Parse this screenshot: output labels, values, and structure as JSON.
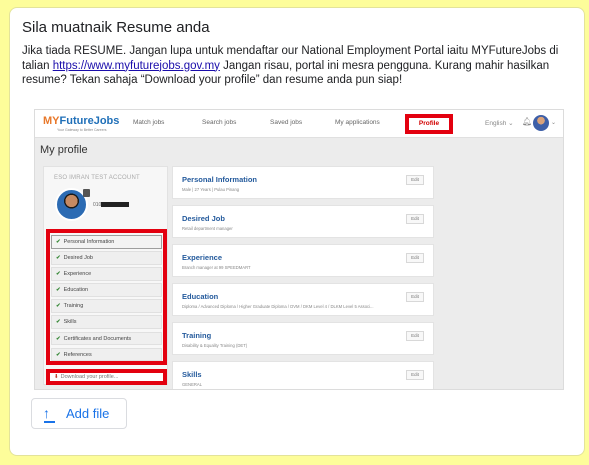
{
  "question": {
    "title": "Sila muatnaik Resume anda",
    "desc_before": "Jika tiada RESUME. Jangan lupa untuk mendaftar our National Employment Portal iaitu MYFutureJobs di talian ",
    "link": "https://www.myfuturejobs.gov.my",
    "desc_after": " Jangan risau, portal ini mesra pengguna. Kurang mahir hasilkan resume? Tekan sahaja “Download your profile” dan resume anda pun siap!"
  },
  "portal": {
    "logo_my": "MY",
    "logo_rest": "FutureJobs",
    "logo_sub": "Your Gateway to Better Careers",
    "nav": [
      "Match jobs",
      "Search jobs",
      "Saved jobs",
      "My applications"
    ],
    "nav_profile": "Profile",
    "lang": "English ⌄",
    "page_title": "My profile",
    "account_name": "ESO IMRAN TEST ACCOUNT",
    "account_id_prefix": "010",
    "menu": [
      "Personal Information",
      "Desired Job",
      "Experience",
      "Education",
      "Training",
      "Skills",
      "Certificates and Documents",
      "References"
    ],
    "download": "Download your profile...",
    "edit_label": "Edit",
    "sections": [
      {
        "title": "Personal Information",
        "sub": "Male  |  27 Years  |  Pulau Pinang"
      },
      {
        "title": "Desired Job",
        "sub": "Retail department manager"
      },
      {
        "title": "Experience",
        "sub": "Branch manager at 99 SPEEDMART"
      },
      {
        "title": "Education",
        "sub": "Diploma / Advanced Diploma / Higher Graduate Diploma / DVM / DKM Level 4 / DLKM Level 5 Associ..."
      },
      {
        "title": "Training",
        "sub": "Disability & Equality Training (DET)"
      },
      {
        "title": "Skills",
        "sub": "GENERAL"
      }
    ]
  },
  "upload": {
    "label": "Add file"
  },
  "colors": {
    "page_bg": "#fdfd9a",
    "highlight_red": "#e3000f",
    "accent_blue": "#1a73e8"
  }
}
